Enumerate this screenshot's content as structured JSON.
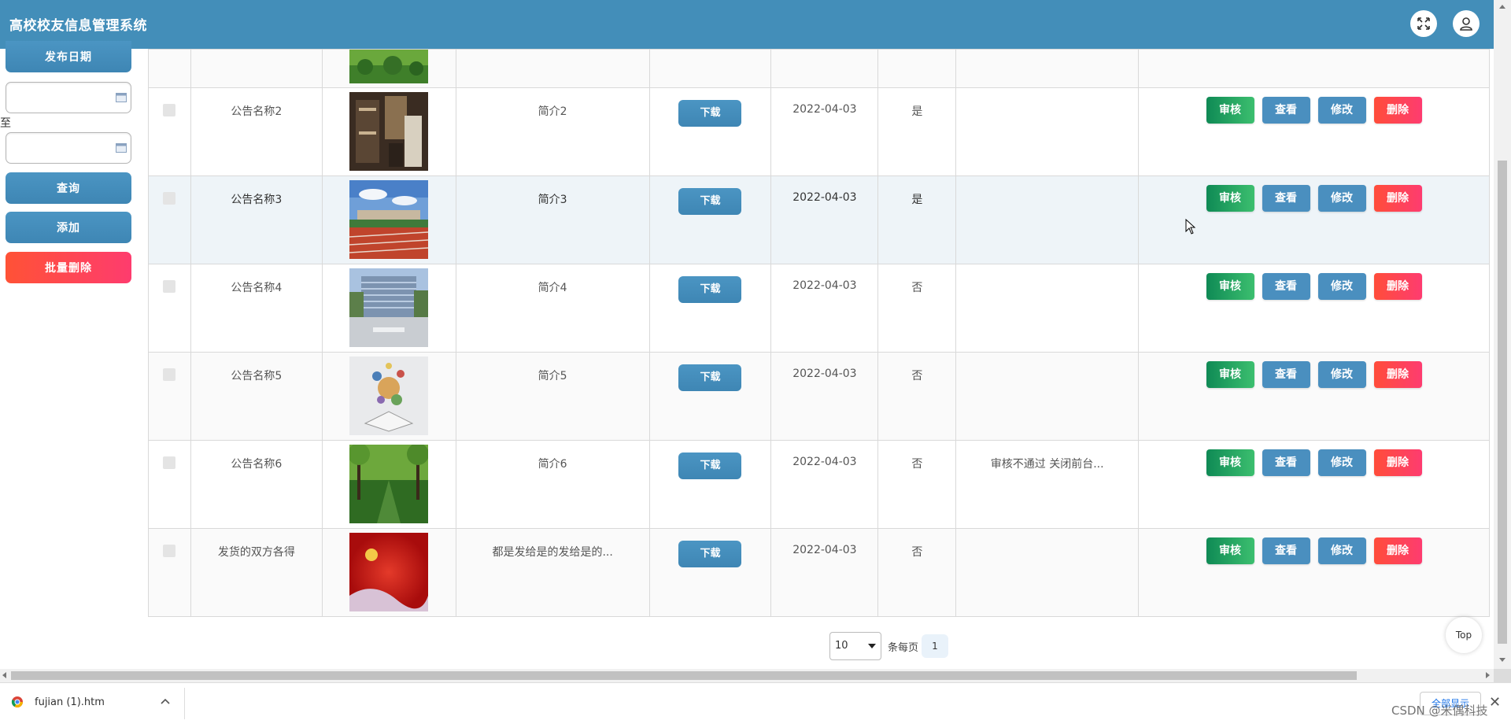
{
  "header": {
    "title": "高校校友信息管理系统",
    "fullscreen_icon": "fullscreen-icon",
    "user_icon": "user-icon"
  },
  "sidebar": {
    "publish_date_label": "发布日期",
    "date_start": {
      "value": "",
      "placeholder": ""
    },
    "to_label": "至",
    "date_end": {
      "value": "",
      "placeholder": ""
    },
    "search_label": "查询",
    "add_label": "添加",
    "batch_delete_label": "批量删除"
  },
  "table": {
    "download_label": "下载",
    "actions": {
      "review": "审核",
      "view": "查看",
      "edit": "修改",
      "delete": "删除"
    },
    "rows": [
      {
        "name": "公告名称2",
        "thumb": "dorm-room",
        "intro": "简介2",
        "date": "2022-04-03",
        "flag": "是",
        "remark": ""
      },
      {
        "name": "公告名称3",
        "thumb": "running-track",
        "intro": "简介3",
        "date": "2022-04-03",
        "flag": "是",
        "remark": ""
      },
      {
        "name": "公告名称4",
        "thumb": "campus-building",
        "intro": "简介4",
        "date": "2022-04-03",
        "flag": "否",
        "remark": ""
      },
      {
        "name": "公告名称5",
        "thumb": "open-book",
        "intro": "简介5",
        "date": "2022-04-03",
        "flag": "否",
        "remark": ""
      },
      {
        "name": "公告名称6",
        "thumb": "tree-lined-path",
        "intro": "简介6",
        "date": "2022-04-03",
        "flag": "否",
        "remark": "审核不通过 关闭前台..."
      },
      {
        "name": "发货的双方各得",
        "thumb": "red-banner",
        "intro": "都是发给是的发给是的...",
        "date": "2022-04-03",
        "flag": "否",
        "remark": ""
      }
    ]
  },
  "pagination": {
    "page_size": "10",
    "per_page_label": "条每页",
    "current_page": "1"
  },
  "back_to_top": "Top",
  "download_bar": {
    "file_name": "fujian (1).htm",
    "show_all": "全部显示"
  },
  "watermark": "CSDN @米偶科技",
  "colors": {
    "header": "#438eb9",
    "primary": "#438eb9",
    "danger": "#fe3c6e",
    "success": "#0f8a55"
  }
}
